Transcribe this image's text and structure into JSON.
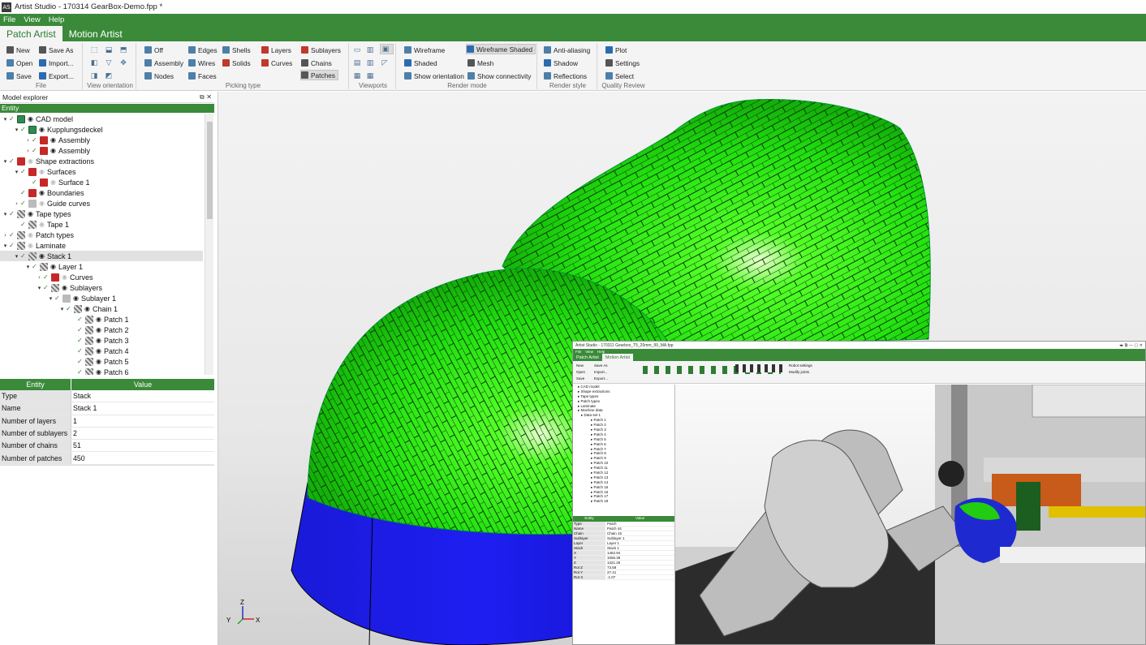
{
  "window": {
    "title": "Artist Studio - 170314 GearBox-Demo.fpp *",
    "icon_text": "AS"
  },
  "menu": [
    "File",
    "View",
    "Help"
  ],
  "ribbon_tabs": [
    {
      "label": "Patch Artist",
      "active": true
    },
    {
      "label": "Motion Artist",
      "active": false
    }
  ],
  "ribbon": {
    "file": {
      "group_label": "File",
      "new": "New",
      "save_as": "Save As",
      "open": "Open",
      "import": "Import...",
      "save": "Save",
      "export": "Export..."
    },
    "view_orientation": {
      "group_label": "View orientation"
    },
    "picking": {
      "group_label": "Picking type",
      "off": "Off",
      "assembly": "Assembly",
      "nodes": "Nodes",
      "edges": "Edges",
      "wires": "Wires",
      "faces": "Faces",
      "shells": "Shells",
      "solids": "Solids",
      "layers": "Layers",
      "curves": "Curves",
      "sublayers": "Sublayers",
      "chains": "Chains",
      "patches": "Patches"
    },
    "viewports": {
      "group_label": "Viewports"
    },
    "render_mode": {
      "group_label": "Render mode",
      "wireframe": "Wireframe",
      "shaded": "Shaded",
      "show_orientation": "Show orientation",
      "wireframe_shaded": "Wireframe Shaded",
      "mesh": "Mesh",
      "show_connectivity": "Show connectivity"
    },
    "render_style": {
      "group_label": "Render style",
      "anti_aliasing": "Anti-aliasing",
      "shadow": "Shadow",
      "reflections": "Reflections"
    },
    "quality": {
      "group_label": "Quality Review",
      "plot": "Plot",
      "settings": "Settings",
      "select": "Select"
    }
  },
  "explorer": {
    "title": "Model explorer",
    "column": "Entity",
    "tree": [
      {
        "label": "CAD model"
      },
      {
        "label": "Kupplungsdeckel"
      },
      {
        "label": "Assembly"
      },
      {
        "label": "Assembly"
      },
      {
        "label": "Shape extractions"
      },
      {
        "label": "Surfaces"
      },
      {
        "label": "Surface 1"
      },
      {
        "label": "Boundaries"
      },
      {
        "label": "Guide curves"
      },
      {
        "label": "Tape types"
      },
      {
        "label": "Tape 1"
      },
      {
        "label": "Patch types"
      },
      {
        "label": "Laminate"
      },
      {
        "label": "Stack 1"
      },
      {
        "label": "Layer 1"
      },
      {
        "label": "Curves"
      },
      {
        "label": "Sublayers"
      },
      {
        "label": "Sublayer 1"
      },
      {
        "label": "Chain 1"
      },
      {
        "label": "Patch 1"
      },
      {
        "label": "Patch 2"
      },
      {
        "label": "Patch 3"
      },
      {
        "label": "Patch 4"
      },
      {
        "label": "Patch 5"
      },
      {
        "label": "Patch 6"
      }
    ]
  },
  "properties": {
    "headers": [
      "Entity",
      "Value"
    ],
    "rows": [
      {
        "key": "Type",
        "value": "Stack"
      },
      {
        "key": "Name",
        "value": "Stack 1"
      },
      {
        "key": "Number of layers",
        "value": "1"
      },
      {
        "key": "Number of sublayers",
        "value": "2"
      },
      {
        "key": "Number of chains",
        "value": "51"
      },
      {
        "key": "Number of patches",
        "value": "450"
      }
    ]
  },
  "viewport": {
    "axis_x": "X",
    "axis_y": "Y",
    "axis_z": "Z",
    "colors": {
      "patches": "#22ee10",
      "base": "#1a1ae0"
    }
  },
  "inset": {
    "title": "Artist Studio - 170311 Gearbox_T5_20mm_99_MA.fpp",
    "menu": [
      "File",
      "View",
      "Help"
    ],
    "tabs": [
      "Patch Artist",
      "Motion Artist"
    ],
    "ribbon_items": {
      "new": "New",
      "open": "Open",
      "save": "Save",
      "save_as": "Save As",
      "import": "Import...",
      "export": "Export...",
      "robot_settings": "Robot settings",
      "modify_joints": "Modify joints"
    },
    "tree": [
      "CAD model",
      "Shape extractions",
      "Tape types",
      "Patch types",
      "Laminate",
      "Machine data",
      "Data set 1",
      "Patch 1",
      "Patch 2",
      "Patch 3",
      "Patch 4",
      "Patch 5",
      "Patch 6",
      "Patch 7",
      "Patch 8",
      "Patch 9",
      "Patch 10",
      "Patch 11",
      "Patch 12",
      "Patch 13",
      "Patch 14",
      "Patch 15",
      "Patch 16",
      "Patch 17",
      "Patch 18"
    ],
    "prop_headers": [
      "Entity",
      "Value"
    ],
    "props": [
      {
        "k": "Type",
        "v": "Patch"
      },
      {
        "k": "Name",
        "v": "Patch 44"
      },
      {
        "k": "Chain",
        "v": "Chain 15"
      },
      {
        "k": "Sublayer",
        "v": "Sublayer 1"
      },
      {
        "k": "Layer",
        "v": "Layer 1"
      },
      {
        "k": "Stack",
        "v": "Stack 1"
      },
      {
        "k": "X",
        "v": "1462.94"
      },
      {
        "k": "Y",
        "v": "1055.38"
      },
      {
        "k": "Z",
        "v": "1321.26"
      },
      {
        "k": "Rot Z",
        "v": "73.58"
      },
      {
        "k": "Rot Y",
        "v": "27.41"
      },
      {
        "k": "Rot X",
        "v": "-1.07"
      }
    ]
  }
}
